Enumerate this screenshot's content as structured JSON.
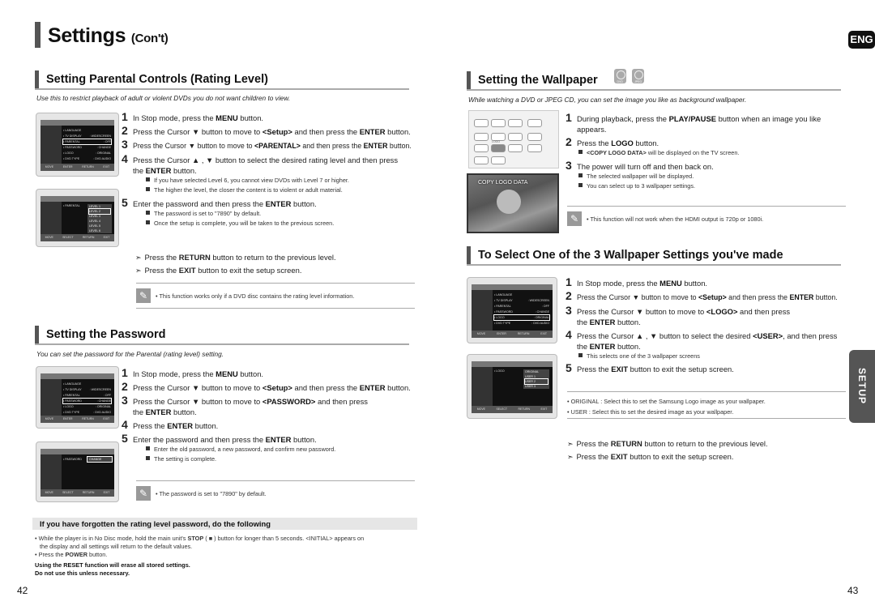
{
  "page": {
    "title": "Settings",
    "title_suffix": "(Con't)",
    "lang_tab": "ENG",
    "side_tab": "SETUP",
    "page_left": "42",
    "page_right": "43"
  },
  "parental": {
    "heading": "Setting Parental Controls (Rating Level)",
    "intro": "Use this to restrict playback of adult or violent DVDs you do not want children to view.",
    "steps": [
      {
        "num": "1",
        "pre": "In Stop mode, press the ",
        "bold": "MENU",
        "post": " button."
      },
      {
        "num": "2",
        "pre": "Press the Cursor ▼ button to move to ",
        "bold": "<Setup>",
        "mid": " and then press the ",
        "bold2": "ENTER",
        "post": " button."
      },
      {
        "num": "3",
        "pre": "Press the Cursor ▼ button to move to ",
        "bold": "<PARENTAL>",
        "mid": " and then press the ",
        "bold2": "ENTER",
        "post": " button."
      },
      {
        "num": "4",
        "pre": "Press the Cursor ▲ , ▼ button to select the desired rating level and then press",
        "line2_pre": "the ",
        "bold": "ENTER",
        "post": " button."
      },
      {
        "num": "5",
        "pre": "Enter the password and then press the ",
        "bold": "ENTER",
        "post": " button."
      }
    ],
    "step4_bullets": [
      "If you have selected Level 6, you cannot view DVDs with Level 7 or higher.",
      "The higher the level, the closer the content is to violent or adult material."
    ],
    "step5_bullets": [
      "The password is set to \"7890\" by default.",
      "Once the setup is complete, you will be taken to the previous screen."
    ],
    "tips": [
      {
        "pre": "Press the ",
        "bold": "RETURN",
        "post": " button to return to the previous level."
      },
      {
        "pre": "Press the ",
        "bold": "EXIT",
        "post": " button to exit the setup screen."
      }
    ],
    "note": "• This function works only if a DVD disc contains the rating level information.",
    "screen1": {
      "header_left": "DVD MENU",
      "header_right": "SETUP",
      "rows": [
        {
          "label": "• LANGUAGE",
          "value": ""
        },
        {
          "label": "• TV DISPLAY",
          "value": ": WIDESCREEN"
        },
        {
          "label": "• PARENTAL",
          "value": ": OFF"
        },
        {
          "label": "• PASSWORD",
          "value": ": CHANGE"
        },
        {
          "label": "• LOGO",
          "value": ": ORIGINAL"
        },
        {
          "label": "• DVD TYPE",
          "value": ": DVD AUDIO"
        }
      ],
      "footer": [
        "MOVE",
        "ENTER",
        "RETURN",
        "EXIT"
      ]
    },
    "screen2": {
      "header_left": "DVD MENU",
      "header_right": "SETUP",
      "row_label": "• PARENTAL",
      "levels": [
        "LEVEL 1",
        "LEVEL 2",
        "LEVEL 3",
        "LEVEL 4",
        "LEVEL 5",
        "LEVEL 6",
        "LEVEL 7",
        "LEVEL 8"
      ],
      "footer": [
        "MOVE",
        "SELECT",
        "RETURN",
        "EXIT"
      ]
    }
  },
  "password": {
    "heading": "Setting the Password",
    "intro": "You can set the password for the Parental (rating level) setting.",
    "steps": [
      {
        "num": "1",
        "pre": "In Stop mode, press the ",
        "bold": "MENU",
        "post": " button."
      },
      {
        "num": "2",
        "pre": "Press the Cursor ▼ button to move to ",
        "bold": "<Setup>",
        "mid": " and then press the ",
        "bold2": "ENTER",
        "post": " button."
      },
      {
        "num": "3",
        "pre": "Press the Cursor ▼ button to move to ",
        "bold": "<PASSWORD>",
        "mid": " and then press",
        "line2_pre": "the ",
        "bold2": "ENTER",
        "post": " button."
      },
      {
        "num": "4",
        "pre": "Press the ",
        "bold": "ENTER",
        "post": " button."
      },
      {
        "num": "5",
        "pre": "Enter the password and then press the ",
        "bold": "ENTER",
        "post": " button."
      }
    ],
    "step5_bullets": [
      "Enter the old password, a new password, and confirm new password.",
      "The setting is complete."
    ],
    "note": "• The password is set to \"7890\" by default.",
    "screen2": {
      "header_left": "DVD MENU",
      "header_right": "SETUP",
      "row_label": "• PASSWORD",
      "value": "CHANGE",
      "footer": [
        "MOVE",
        "SELECT",
        "RETURN",
        "EXIT"
      ]
    }
  },
  "forgot": {
    "heading": "If you have forgotten the rating level password, do the following",
    "line1_pre": "• While the player is in No Disc mode, hold the main unit's ",
    "line1_bold": "STOP",
    "line1_post": " ( ■ ) button for longer than 5 seconds. <INITIAL> appears on",
    "line2": "the display and all settings will return to the default values.",
    "line3_pre": "• Press the ",
    "line3_bold": "POWER",
    "line3_post": " button.",
    "warn1": "Using the RESET function will erase all stored settings.",
    "warn2": "Do not use this unless necessary."
  },
  "wallpaper": {
    "heading": "Setting the Wallpaper",
    "disc_icons": [
      "DVD",
      "JPEG"
    ],
    "intro": "While watching a DVD or JPEG CD, you can set the image you like as background wallpaper.",
    "photo_caption": "COPY LOGO DATA",
    "remote_labels": [
      "DIMMER",
      "DSP/EQ",
      "MODE",
      "P.SCAN",
      "INFO",
      "POWER",
      "SLOW",
      "TEST TONE",
      "SOUND EDIT",
      "ZOOM",
      "LOGO",
      "SLIDE MODE",
      "DIGEST",
      "SUBTITLE",
      "EZ VIEW"
    ],
    "steps": [
      {
        "num": "1",
        "pre": "During playback, press the ",
        "bold": "PLAY/PAUSE",
        "post": " button when an image you like",
        "line2": "appears."
      },
      {
        "num": "2",
        "pre": "Press the ",
        "bold": "LOGO",
        "post": " button."
      },
      {
        "num": "3",
        "pre": "The power will turn off and then back on."
      }
    ],
    "step2_bullet_bold": "<COPY LOGO DATA>",
    "step2_bullet_post": " will be displayed on the TV screen.",
    "step3_bullets": [
      "The selected wallpaper will be displayed.",
      "You can select up to 3 wallpaper settings."
    ],
    "note": "• This function will not work when the HDMI output is 720p or 1080i."
  },
  "select": {
    "heading": "To Select One of the 3 Wallpaper Settings you've made",
    "steps": [
      {
        "num": "1",
        "pre": "In Stop mode, press the ",
        "bold": "MENU",
        "post": " button."
      },
      {
        "num": "2",
        "pre": "Press the Cursor ▼ button to move to ",
        "bold": "<Setup>",
        "mid": " and then press the ",
        "bold2": "ENTER",
        "post": " button."
      },
      {
        "num": "3",
        "pre": "Press the Cursor ▼ button to move to ",
        "bold": "<LOGO>",
        "mid": " and then press",
        "line2_pre": "the ",
        "bold2": "ENTER",
        "post": " button."
      },
      {
        "num": "4",
        "pre": "Press the Cursor ▲ , ▼ button to select the desired ",
        "bold": "<USER>",
        "mid": ", and then press",
        "line2_pre": "the ",
        "bold2": "ENTER",
        "post": " button."
      },
      {
        "num": "5",
        "pre": "Press the ",
        "bold": "EXIT",
        "post": " button to exit the setup screen."
      }
    ],
    "step4_bullet": "This selects one of the 3 wallpaper screens",
    "info": [
      "• ORIGINAL : Select this to set the Samsung Logo image as your wallpaper.",
      "• USER : Select this to set the desired image as your wallpaper."
    ],
    "tips": [
      {
        "pre": "Press the ",
        "bold": "RETURN",
        "post": " button to return to the previous level."
      },
      {
        "pre": "Press the ",
        "bold": "EXIT",
        "post": " button to exit the setup screen."
      }
    ],
    "screen2": {
      "header_left": "DVD MENU",
      "header_right": "SETUP",
      "row_label": "• LOGO",
      "options": [
        "ORIGINAL",
        "USER 1",
        "USER 2",
        "USER 3"
      ],
      "footer": [
        "MOVE",
        "SELECT",
        "RETURN",
        "EXIT"
      ]
    }
  }
}
